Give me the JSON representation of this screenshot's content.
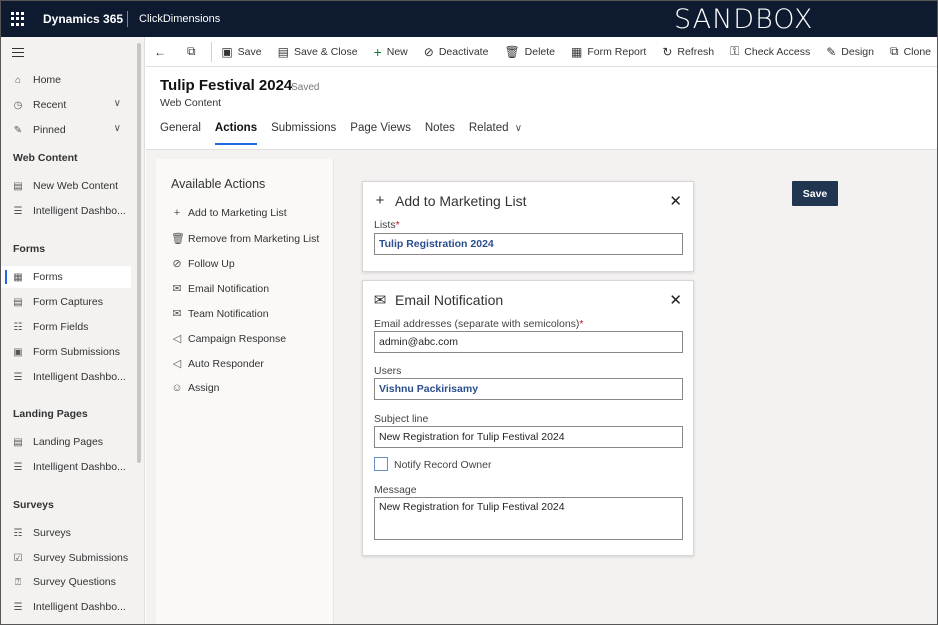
{
  "topbar": {
    "brand": "Dynamics 365",
    "app": "ClickDimensions",
    "environment": "SANDBOX"
  },
  "sidebar": {
    "home": "Home",
    "recent": "Recent",
    "pinned": "Pinned",
    "groups": {
      "web_content": "Web Content",
      "forms": "Forms",
      "landing_pages": "Landing Pages",
      "surveys": "Surveys"
    },
    "items": {
      "new_web_content": "New Web Content",
      "intelligent_dash_1": "Intelligent Dashbo...",
      "forms": "Forms",
      "form_captures": "Form Captures",
      "form_fields": "Form Fields",
      "form_submissions": "Form Submissions",
      "intelligent_dash_2": "Intelligent Dashbo...",
      "landing_pages": "Landing Pages",
      "intelligent_dash_3": "Intelligent Dashbo...",
      "surveys": "Surveys",
      "survey_submissions": "Survey Submissions",
      "survey_questions": "Survey Questions",
      "intelligent_dash_4": "Intelligent Dashbo..."
    }
  },
  "commands": {
    "save": "Save",
    "save_close": "Save & Close",
    "new": "New",
    "deactivate": "Deactivate",
    "delete": "Delete",
    "form_report": "Form Report",
    "refresh": "Refresh",
    "check_access": "Check Access",
    "design": "Design",
    "clone": "Clone"
  },
  "record": {
    "title": "Tulip Festival 2024",
    "status": "- Saved",
    "entity": "Web Content"
  },
  "tabs": {
    "general": "General",
    "actions": "Actions",
    "submissions": "Submissions",
    "page_views": "Page Views",
    "notes": "Notes",
    "related": "Related"
  },
  "available_actions": {
    "title": "Available Actions",
    "items": {
      "add_to_list": "Add to Marketing List",
      "remove_from_list": "Remove from Marketing List",
      "follow_up": "Follow Up",
      "email_notification": "Email Notification",
      "team_notification": "Team Notification",
      "campaign_response": "Campaign Response",
      "auto_responder": "Auto Responder",
      "assign": "Assign"
    }
  },
  "save_button": "Save",
  "marketing_card": {
    "title": "Add to Marketing List",
    "lists_label": "Lists",
    "required_mark": "*",
    "lists_value": "Tulip Registration 2024"
  },
  "email_card": {
    "title": "Email Notification",
    "email_label": "Email addresses (separate with semicolons)",
    "required_mark": "*",
    "email_value": "admin@abc.com",
    "users_label": "Users",
    "users_value": "Vishnu Packirisamy",
    "subject_label": "Subject line",
    "subject_value": "New Registration for Tulip Festival 2024",
    "notify_label": "Notify Record Owner",
    "notify_checked": false,
    "message_label": "Message",
    "message_value": "New Registration for Tulip Festival 2024"
  },
  "colors": {
    "topbar_bg": "#0d1a2f",
    "accent": "#2266e3",
    "save_btn": "#1f3550",
    "lookup_text": "#2b4e8f"
  }
}
